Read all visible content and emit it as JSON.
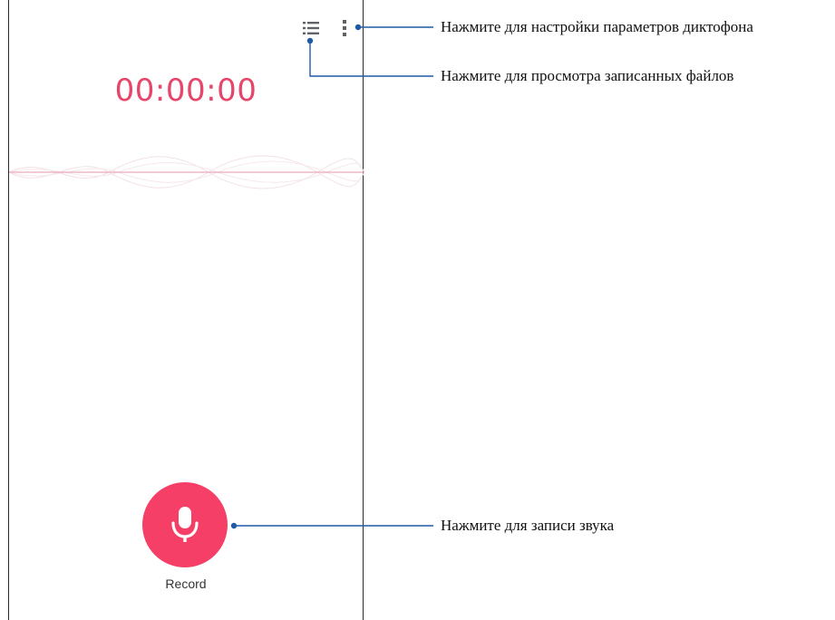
{
  "app": {
    "timer": "00:00:00",
    "record_label": "Record",
    "toolbar": {
      "list_icon": "list-icon",
      "more_icon": "more-vert-icon"
    },
    "accent_color": "#f53f66"
  },
  "callouts": {
    "settings": "Нажмите для настройки параметров диктофона",
    "files": "Нажмите для просмотра записанных файлов",
    "record": "Нажмите для записи звука"
  },
  "colors": {
    "callout_line": "#1f5aa6",
    "timer": "#e8456b"
  }
}
